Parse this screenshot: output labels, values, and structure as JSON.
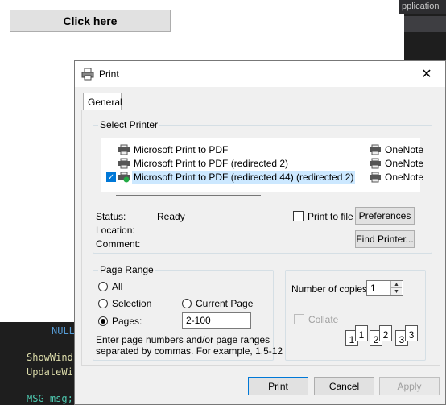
{
  "background": {
    "button_label": "Click here",
    "title_fragment": "pplication",
    "code_lines": [
      "NULL",
      "ShowWind",
      "UpdateWi",
      "MSG msg;"
    ]
  },
  "dialog": {
    "title": "Print",
    "close_glyph": "✕",
    "tab_general": "General",
    "select_printer": {
      "legend": "Select Printer",
      "printers": [
        {
          "name": "Microsoft Print to PDF",
          "selected": false
        },
        {
          "name": "Microsoft Print to PDF (redirected 2)",
          "selected": false
        },
        {
          "name": "Microsoft Print to PDF (redirected 44) (redirected 2)",
          "selected": true
        }
      ],
      "right_printers": [
        "OneNote",
        "OneNote",
        "OneNote"
      ],
      "status_label": "Status:",
      "status_value": "Ready",
      "location_label": "Location:",
      "comment_label": "Comment:",
      "print_to_file_label": "Print to file",
      "print_to_file_checked": false,
      "preferences_button": "Preferences",
      "find_printer_button": "Find Printer..."
    },
    "page_range": {
      "legend": "Page Range",
      "all_label": "All",
      "selection_label": "Selection",
      "current_page_label": "Current Page",
      "pages_label": "Pages:",
      "pages_value": "2-100",
      "selected_option": "pages",
      "hint_line1": "Enter page numbers and/or page ranges",
      "hint_line2": "separated by commas.  For example, 1,5-12"
    },
    "copies": {
      "label": "Number of copies:",
      "value": "1",
      "collate_label": "Collate",
      "collate_checked": false,
      "collate_disabled": true,
      "collate_pages": [
        "1",
        "1",
        "2",
        "2",
        "3",
        "3"
      ]
    },
    "buttons": {
      "print": "Print",
      "cancel": "Cancel",
      "apply": "Apply"
    }
  },
  "colors": {
    "selection": "#cce8ff",
    "accent": "#0078d7",
    "ok_green": "#22aa44"
  }
}
